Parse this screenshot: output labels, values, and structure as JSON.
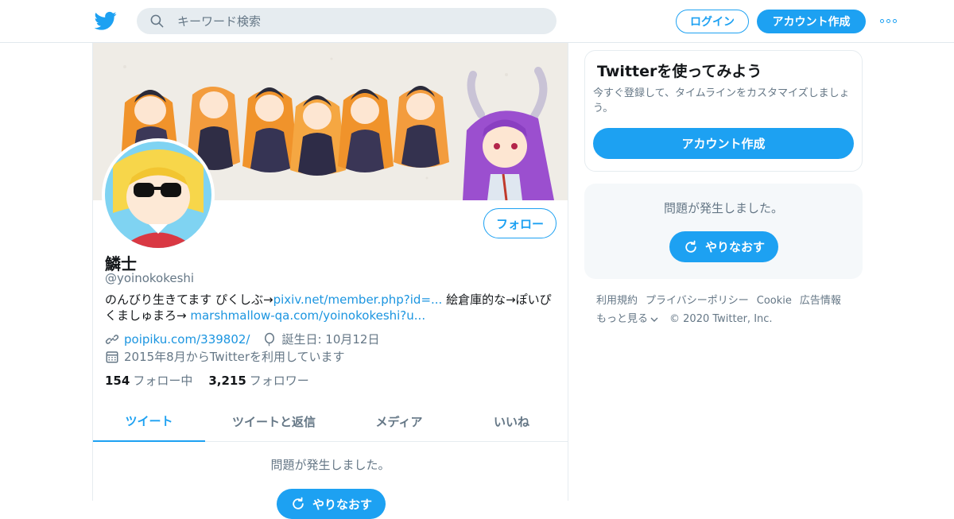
{
  "header": {
    "search_placeholder": "キーワード検索",
    "login_label": "ログイン",
    "signup_label": "アカウント作成"
  },
  "profile": {
    "name": "鱗士",
    "handle": "@yoinokokeshi",
    "bio_text_1": "のんびり生きてます ぴくしぶ→",
    "bio_link_1": "pixiv.net/member.php?id=...",
    "bio_text_2": " 絵倉庫的な→ぽいぴくましゅまろ→ ",
    "bio_link_2": "marshmallow-qa.com/yoinokokeshi?u...",
    "website": "poipiku.com/339802/",
    "birthday": "誕生日: 10月12日",
    "joined": "2015年8月からTwitterを利用しています",
    "following_count": "154",
    "following_label": "フォロー中",
    "followers_count": "3,215",
    "followers_label": "フォロワー",
    "follow_button": "フォロー"
  },
  "tabs": [
    {
      "label": "ツイート",
      "active": true
    },
    {
      "label": "ツイートと返信"
    },
    {
      "label": "メディア"
    },
    {
      "label": "いいね"
    }
  ],
  "timeline": {
    "error": "問題が発生しました。",
    "retry": "やりなおす"
  },
  "sidebar": {
    "join_title": "Twitterを使ってみよう",
    "join_desc": "今すぐ登録して、タイムラインをカスタマイズしましょう。",
    "join_cta": "アカウント作成",
    "error": "問題が発生しました。",
    "retry": "やりなおす"
  },
  "footer": {
    "terms": "利用規約",
    "privacy": "プライバシーポリシー",
    "cookie": "Cookie",
    "ads": "広告情報",
    "more": "もっと見る",
    "copyright": "© 2020 Twitter, Inc."
  },
  "colors": {
    "accent": "#1da1f2",
    "link": "#1b95e0",
    "muted": "#657786"
  }
}
